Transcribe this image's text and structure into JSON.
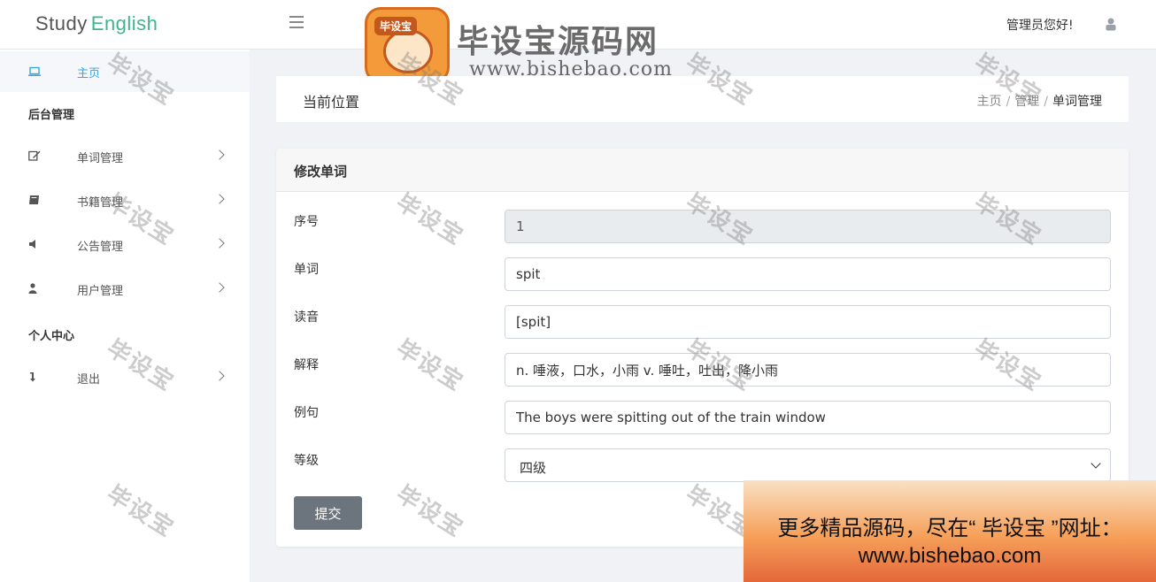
{
  "header": {
    "logo_word1": "Study",
    "logo_word2": "English",
    "greeting": "管理员您好!"
  },
  "watermark_banner": {
    "badge_text": "毕设宝",
    "title": "毕设宝源码网",
    "url": "www.bishebao.com"
  },
  "sidebar": {
    "home_label": "主页",
    "section_admin": "后台管理",
    "items": [
      {
        "label": "单词管理",
        "icon": "edit-icon"
      },
      {
        "label": "书籍管理",
        "icon": "book-icon"
      },
      {
        "label": "公告管理",
        "icon": "megaphone-icon"
      },
      {
        "label": "用户管理",
        "icon": "user-icon"
      }
    ],
    "section_personal": "个人中心",
    "logout_label": "退出"
  },
  "breadcrumb": {
    "title": "当前位置",
    "trail": [
      "主页",
      "管理",
      "单词管理"
    ],
    "separator": "/"
  },
  "form": {
    "heading": "修改单词",
    "fields": [
      {
        "label": "序号",
        "value": "1",
        "disabled": true
      },
      {
        "label": "单词",
        "value": "spit"
      },
      {
        "label": "读音",
        "value": "[spit]"
      },
      {
        "label": "解释",
        "value": "n. 唾液，口水，小雨 v. 唾吐，吐出，降小雨"
      },
      {
        "label": "例句",
        "value": "The boys were spitting out of the train window"
      }
    ],
    "level_label": "等级",
    "level_value": "四级",
    "submit_label": "提交"
  },
  "watermark_text": "毕设宝",
  "promo": {
    "line1": "更多精品源码，尽在“ 毕设宝 ”网址：",
    "line2": "www.bishebao.com"
  },
  "colors": {
    "accent": "#3aa8d9",
    "logo_green": "#3fb58f",
    "button_gray": "#6c757d"
  }
}
